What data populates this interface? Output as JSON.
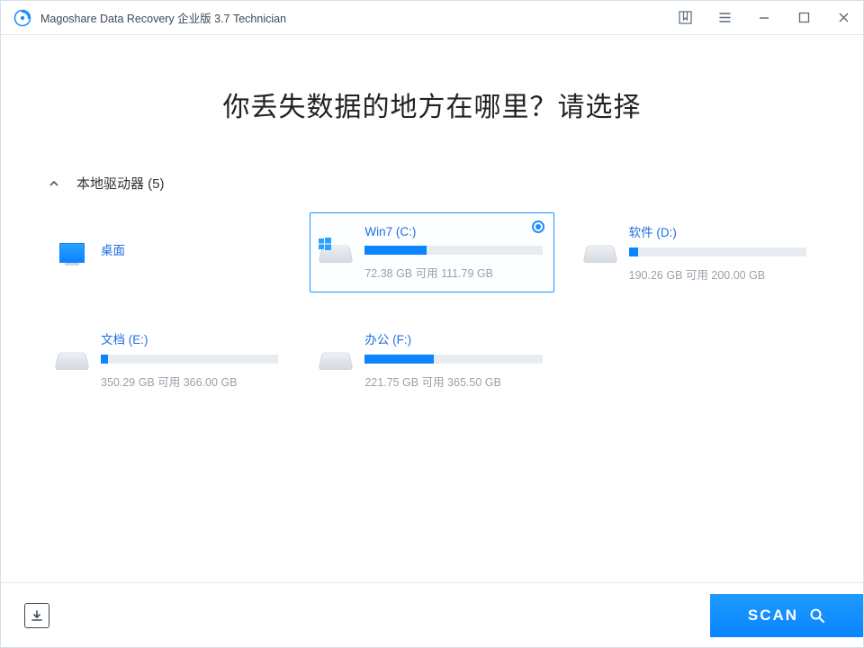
{
  "titlebar": {
    "app_title": "Magoshare Data Recovery 企业版 3.7 Technician"
  },
  "headline": "你丢失数据的地方在哪里？请选择",
  "section": {
    "title": "本地驱动器 (5)"
  },
  "stats_label": {
    "available": "可用"
  },
  "drives": [
    {
      "id": "desktop",
      "name": "桌面",
      "selected": false,
      "has_size": false,
      "icon": "desktop"
    },
    {
      "id": "c",
      "name": "Win7 (C:)",
      "selected": true,
      "has_size": true,
      "used_gb": 72.38,
      "total_gb": 111.79,
      "icon": "windows",
      "used_label": "72.38 GB",
      "total_label": "111.79 GB",
      "fill_pct": 35
    },
    {
      "id": "d",
      "name": "软件 (D:)",
      "selected": false,
      "has_size": true,
      "used_gb": 190.26,
      "total_gb": 200.0,
      "icon": "hdd",
      "used_label": "190.26 GB",
      "total_label": "200.00 GB",
      "fill_pct": 5
    },
    {
      "id": "e",
      "name": "文档 (E:)",
      "selected": false,
      "has_size": true,
      "used_gb": 350.29,
      "total_gb": 366.0,
      "icon": "hdd",
      "used_label": "350.29 GB",
      "total_label": "366.00 GB",
      "fill_pct": 4
    },
    {
      "id": "f",
      "name": "办公 (F:)",
      "selected": false,
      "has_size": true,
      "used_gb": 221.75,
      "total_gb": 365.5,
      "icon": "hdd",
      "used_label": "221.75 GB",
      "total_label": "365.50 GB",
      "fill_pct": 39
    }
  ],
  "footer": {
    "scan_label": "SCAN"
  }
}
